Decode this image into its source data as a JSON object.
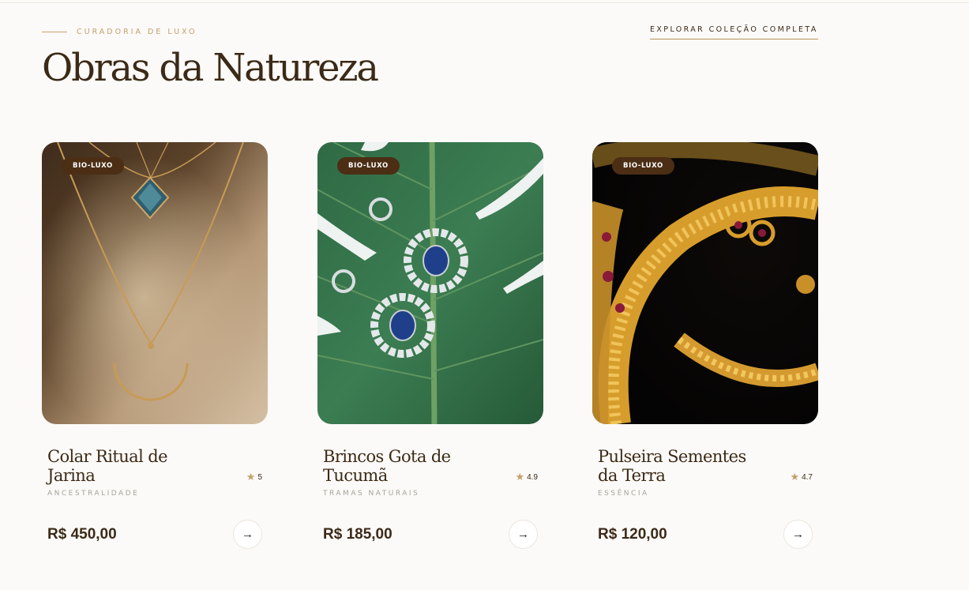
{
  "header": {
    "eyebrow": "CURADORIA DE LUXO",
    "title": "Obras da Natureza",
    "explore_link": "EXPLORAR COLEÇÃO COMPLETA"
  },
  "products": [
    {
      "badge": "BIO-LUXO",
      "name": "Colar Ritual de Jarina",
      "rating": "5",
      "category": "ANCESTRALIDADE",
      "price": "R$ 450,00",
      "arrow_icon": "arrow-right-icon"
    },
    {
      "badge": "BIO-LUXO",
      "name": "Brincos Gota de Tucumã",
      "rating": "4.9",
      "category": "TRAMAS NATURAIS",
      "price": "R$ 185,00",
      "arrow_icon": "arrow-right-icon"
    },
    {
      "badge": "BIO-LUXO",
      "name": "Pulseira Sementes da Terra",
      "rating": "4.7",
      "category": "ESSÊNCIA",
      "price": "R$ 120,00",
      "arrow_icon": "arrow-right-icon"
    }
  ],
  "colors": {
    "background": "#fcfaf8",
    "accent_gold": "#c1a06a",
    "text_dark": "#3b2a17",
    "badge_bg": "#4b2e14"
  }
}
